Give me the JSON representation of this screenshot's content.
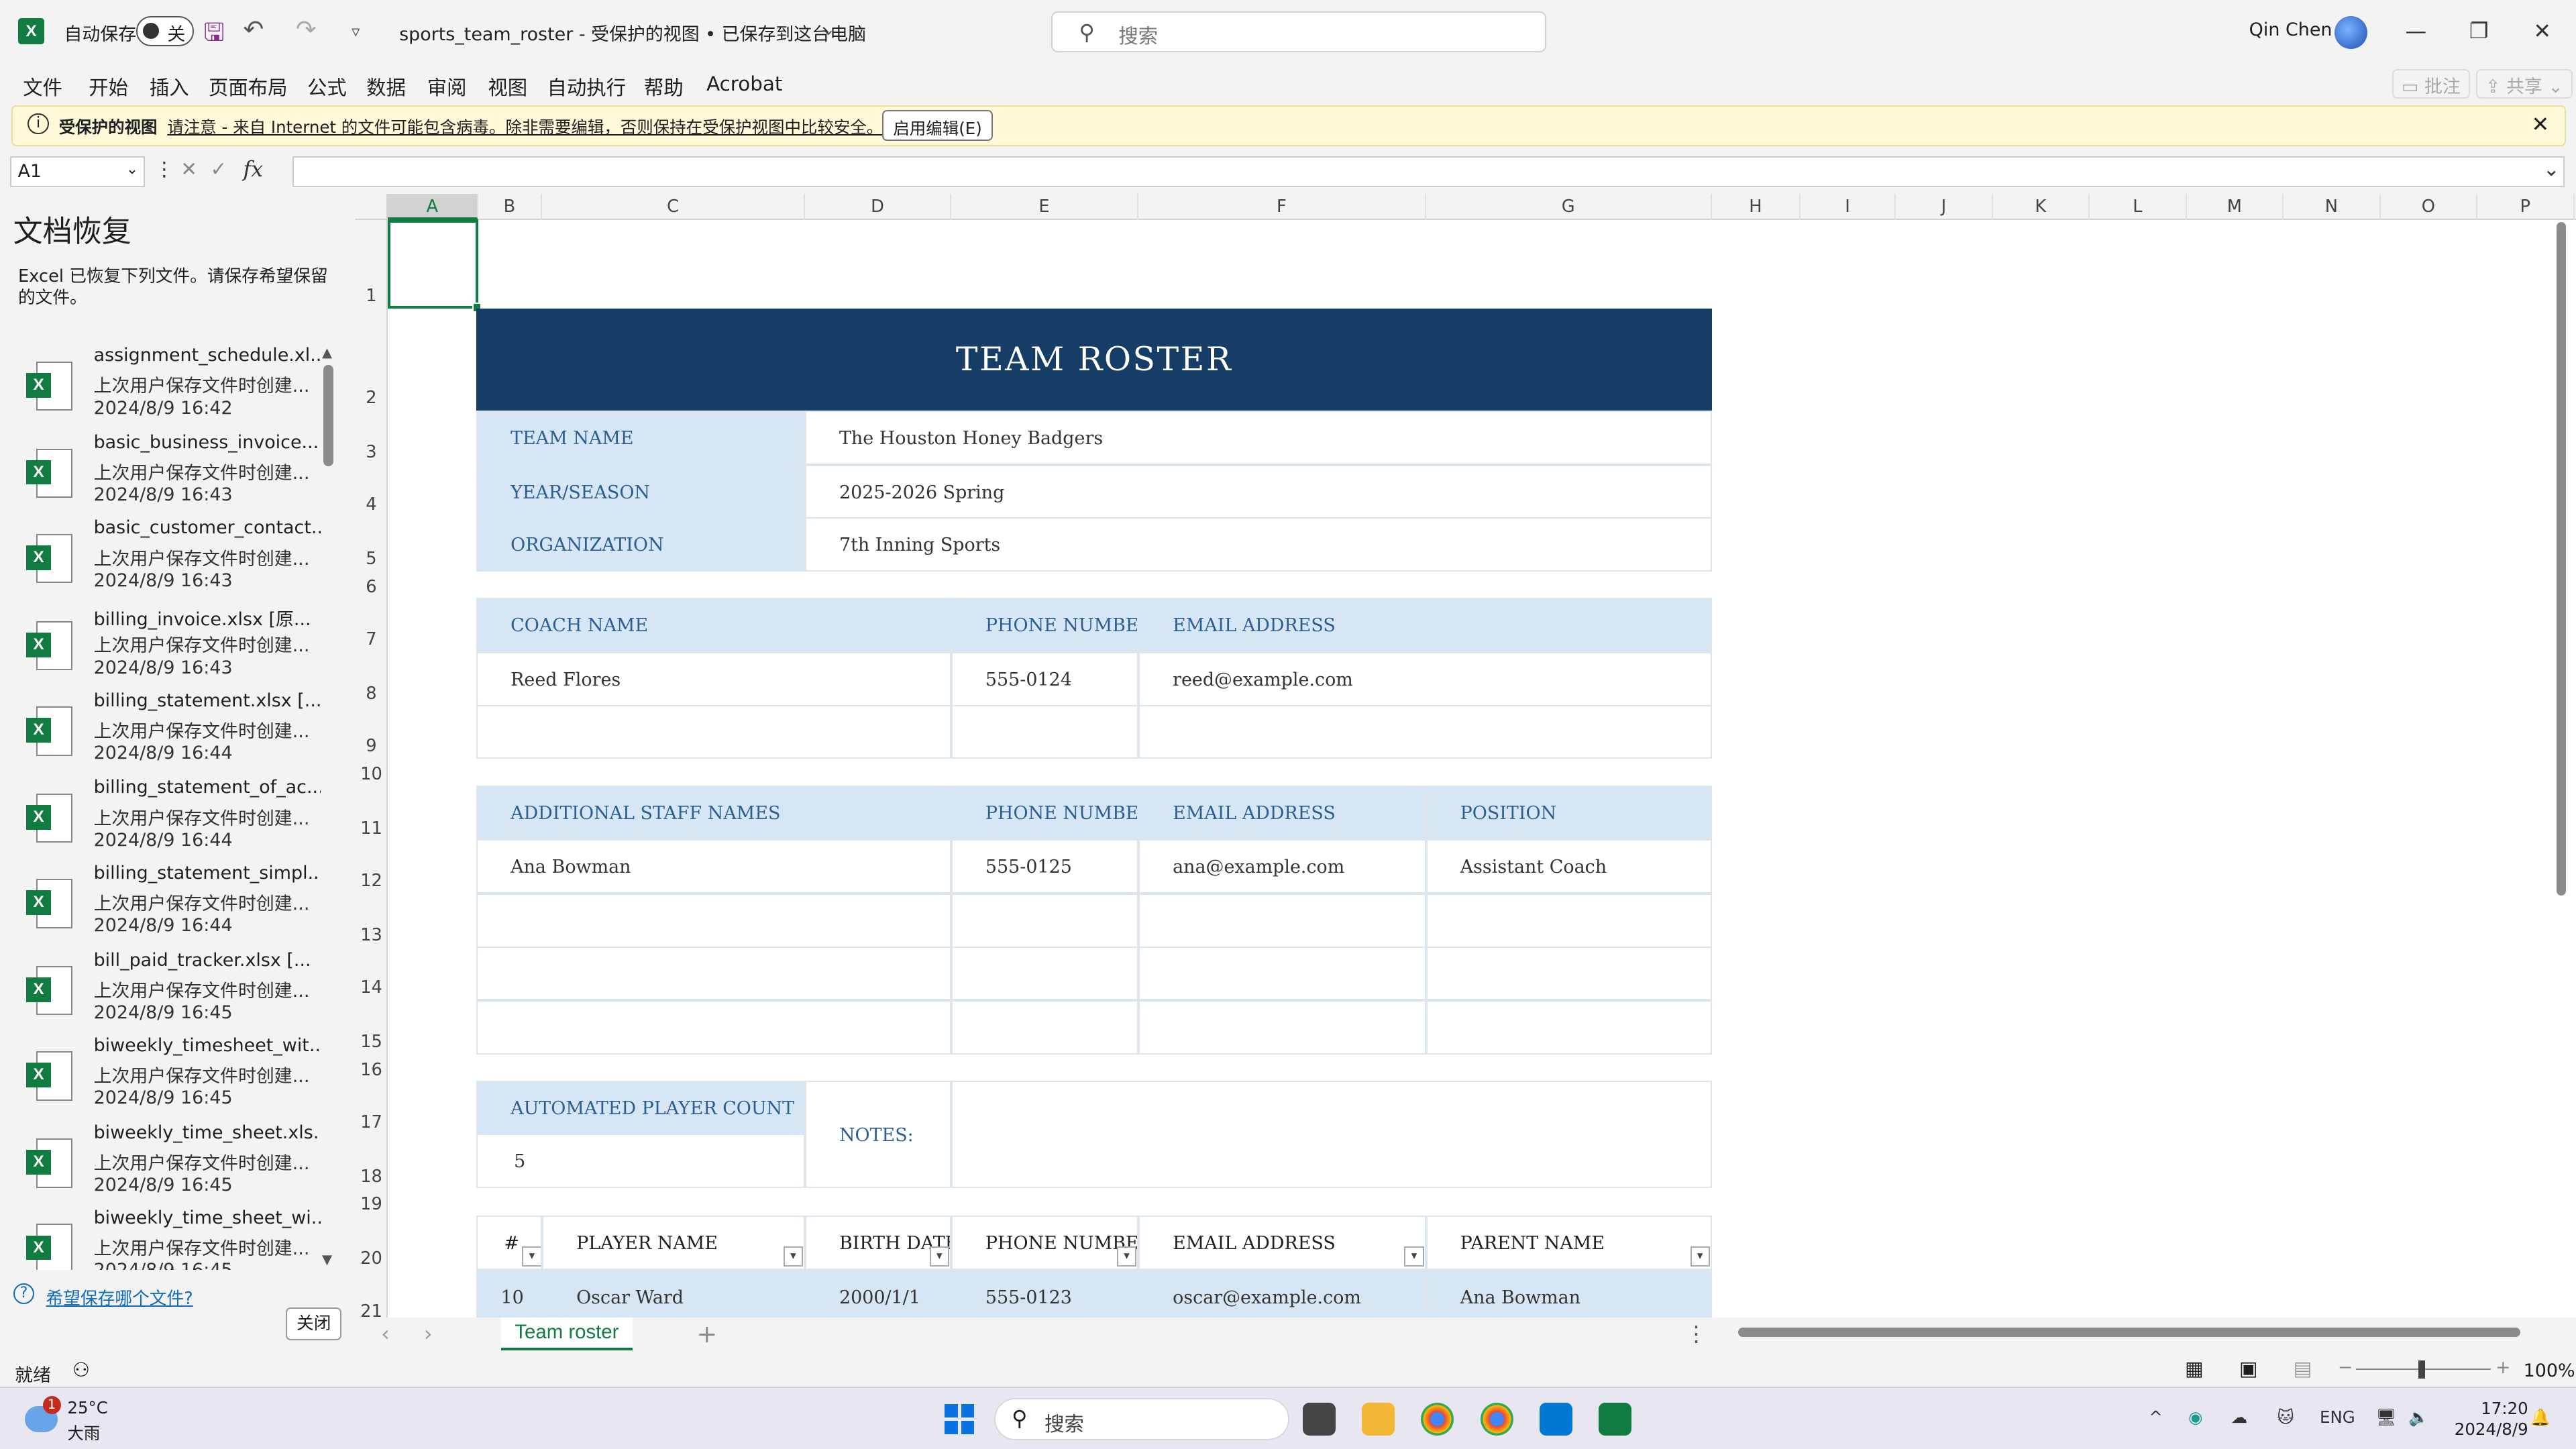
{
  "titlebar": {
    "app_icon": "X",
    "autosave_label": "自动保存",
    "autosave_state": "关",
    "doc_title": "sports_team_roster  -  受保护的视图 • 已保存到这台电脑",
    "search_placeholder": "搜索",
    "user_name": "Qin Chen"
  },
  "menu": {
    "items": [
      "文件",
      "开始",
      "插入",
      "页面布局",
      "公式",
      "数据",
      "审阅",
      "视图",
      "自动执行",
      "帮助",
      "Acrobat"
    ],
    "comments_label": "批注",
    "share_label": "共享"
  },
  "protected_bar": {
    "title": "受保护的视图",
    "message": "请注意 - 来自 Internet 的文件可能包含病毒。除非需要编辑，否则保持在受保护视图中比较安全。",
    "enable_button": "启用编辑(E)"
  },
  "formula_bar": {
    "name_box": "A1",
    "fx": "fx",
    "formula": ""
  },
  "recovery": {
    "title": "文档恢复",
    "description": "Excel 已恢复下列文件。请保存希望保留的文件。",
    "files": [
      {
        "name": "assignment_schedule.xl...",
        "sub": "上次用户保存文件时创建...",
        "date": "2024/8/9 16:42"
      },
      {
        "name": "basic_business_invoice....",
        "sub": "上次用户保存文件时创建...",
        "date": "2024/8/9 16:43"
      },
      {
        "name": "basic_customer_contact...",
        "sub": "上次用户保存文件时创建...",
        "date": "2024/8/9 16:43"
      },
      {
        "name": "billing_invoice.xlsx  [原...",
        "sub": "上次用户保存文件时创建...",
        "date": "2024/8/9 16:43"
      },
      {
        "name": "billing_statement.xlsx  [...",
        "sub": "上次用户保存文件时创建...",
        "date": "2024/8/9 16:44"
      },
      {
        "name": "billing_statement_of_ac...",
        "sub": "上次用户保存文件时创建...",
        "date": "2024/8/9 16:44"
      },
      {
        "name": "billing_statement_simpl...",
        "sub": "上次用户保存文件时创建...",
        "date": "2024/8/9 16:44"
      },
      {
        "name": "bill_paid_tracker.xlsx  [...",
        "sub": "上次用户保存文件时创建...",
        "date": "2024/8/9 16:45"
      },
      {
        "name": "biweekly_timesheet_wit...",
        "sub": "上次用户保存文件时创建...",
        "date": "2024/8/9 16:45"
      },
      {
        "name": "biweekly_time_sheet.xls...",
        "sub": "上次用户保存文件时创建...",
        "date": "2024/8/9 16:45"
      },
      {
        "name": "biweekly_time_sheet_wi...",
        "sub": "上次用户保存文件时创建...",
        "date": "2024/8/9 16:45"
      }
    ],
    "help_link": "希望保存哪个文件?",
    "close_button": "关闭"
  },
  "columns": [
    "A",
    "B",
    "C",
    "D",
    "E",
    "F",
    "G",
    "H",
    "I",
    "J",
    "K",
    "L",
    "M",
    "N",
    "O",
    "P"
  ],
  "rows": [
    "1",
    "2",
    "3",
    "4",
    "5",
    "6",
    "7",
    "8",
    "9",
    "10",
    "11",
    "12",
    "13",
    "14",
    "15",
    "16",
    "17",
    "18",
    "19",
    "20",
    "21"
  ],
  "roster": {
    "banner": "TEAM ROSTER",
    "team_name_label": "TEAM NAME",
    "team_name": "The Houston Honey Badgers",
    "season_label": "YEAR/SEASON",
    "season": "2025-2026 Spring",
    "org_label": "ORGANIZATION",
    "org": "7th Inning Sports",
    "coach": {
      "headers": [
        "COACH NAME",
        "PHONE NUMBER",
        "EMAIL ADDRESS"
      ],
      "name": "Reed Flores",
      "phone": "555-0124",
      "email": "reed@example.com"
    },
    "staff": {
      "headers": [
        "ADDITIONAL STAFF NAMES",
        "PHONE NUMBER",
        "EMAIL ADDRESS",
        "POSITION"
      ],
      "name": "Ana Bowman",
      "phone": "555-0125",
      "email": "ana@example.com",
      "position": "Assistant Coach"
    },
    "player_count_label": "AUTOMATED PLAYER COUNT",
    "player_count": "5",
    "notes_label": "NOTES:",
    "players": {
      "headers": [
        "#",
        "PLAYER NAME",
        "BIRTH DATE",
        "PHONE NUMBER",
        "EMAIL ADDRESS",
        "PARENT NAME"
      ],
      "first_row": {
        "num": "10",
        "name": "Oscar Ward",
        "birth": "2000/1/1",
        "phone": "555-0123",
        "email": "oscar@example.com",
        "parent": "Ana Bowman"
      }
    }
  },
  "sheet_tab": "Team roster",
  "status": {
    "ready": "就绪",
    "zoom": "100%"
  },
  "taskbar": {
    "weather_badge": "1",
    "temperature": "25°C",
    "condition": "大雨",
    "search": "搜索",
    "lang": "ENG",
    "time": "17:20",
    "date": "2024/8/9"
  }
}
